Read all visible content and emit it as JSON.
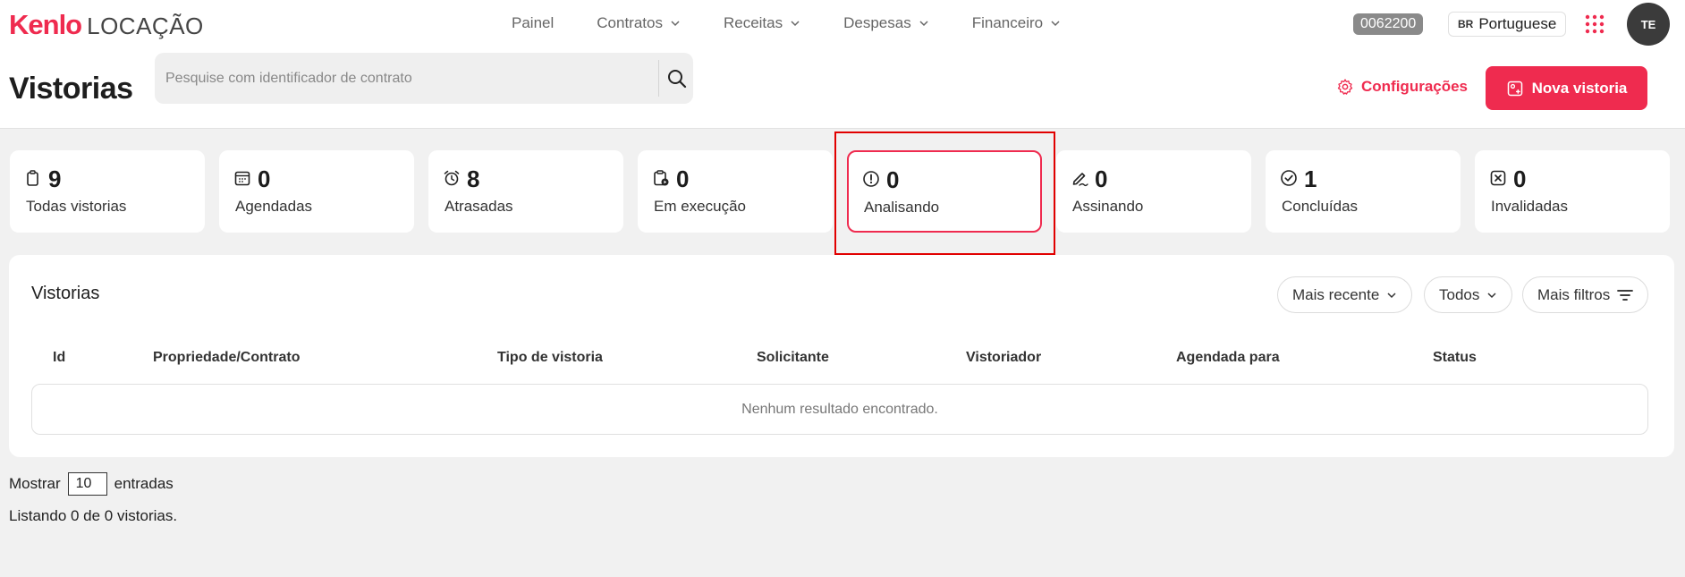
{
  "brand": {
    "logo_brand": "Kenlo",
    "logo_product": "LOCAÇÃO",
    "accent_color": "#ef2b4f"
  },
  "nav": [
    {
      "label": "Painel",
      "dropdown": false
    },
    {
      "label": "Contratos",
      "dropdown": true
    },
    {
      "label": "Receitas",
      "dropdown": true
    },
    {
      "label": "Despesas",
      "dropdown": true
    },
    {
      "label": "Financeiro",
      "dropdown": true
    }
  ],
  "header": {
    "account_code": "0062200",
    "lang_flag": "BR",
    "language": "Portuguese",
    "avatar_initials": "TE"
  },
  "page": {
    "title": "Vistorias",
    "search_placeholder": "Pesquise com identificador de contrato",
    "config_label": "Configurações",
    "new_button_label": "Nova vistoria"
  },
  "stats": [
    {
      "count": "9",
      "label": "Todas vistorias",
      "icon": "clipboard-icon"
    },
    {
      "count": "0",
      "label": "Agendadas",
      "icon": "calendar-icon"
    },
    {
      "count": "8",
      "label": "Atrasadas",
      "icon": "alarm-clock-icon"
    },
    {
      "count": "0",
      "label": "Em execução",
      "icon": "clipboard-play-icon"
    },
    {
      "count": "0",
      "label": "Analisando",
      "icon": "alert-circle-icon",
      "selected": true
    },
    {
      "count": "0",
      "label": "Assinando",
      "icon": "pen-signature-icon"
    },
    {
      "count": "1",
      "label": "Concluídas",
      "icon": "check-circle-icon"
    },
    {
      "count": "0",
      "label": "Invalidadas",
      "icon": "x-square-icon"
    }
  ],
  "table": {
    "title": "Vistorias",
    "filters": {
      "sort": "Mais recente",
      "status": "Todos",
      "more": "Mais filtros"
    },
    "columns": [
      "Id",
      "Propriedade/Contrato",
      "Tipo de vistoria",
      "Solicitante",
      "Vistoriador",
      "Agendada para",
      "Status"
    ],
    "rows": [],
    "empty_message": "Nenhum resultado encontrado."
  },
  "footer": {
    "show_label": "Mostrar",
    "entries_value": "10",
    "entries_label": "entradas",
    "listing_text": "Listando 0 de 0 vistorias."
  }
}
